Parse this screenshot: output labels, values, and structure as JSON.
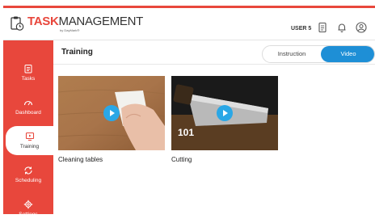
{
  "app": {
    "logo_task": "TASK",
    "logo_management": "MANAGEMENT",
    "logo_sub": "by DayMark®",
    "user_label": "USER 5",
    "accent_color": "#e8473c",
    "video_color": "#1e8fd6"
  },
  "header": {
    "icons": [
      "report-icon",
      "bell-icon",
      "user-circle-icon"
    ]
  },
  "sidebar": {
    "items": [
      {
        "label": "Tasks",
        "icon": "clipboard-icon",
        "active": false
      },
      {
        "label": "Dashboard",
        "icon": "speedometer-icon",
        "active": false
      },
      {
        "label": "Training",
        "icon": "training-screen-icon",
        "active": true
      },
      {
        "label": "Scheduling",
        "icon": "refresh-icon",
        "active": false
      },
      {
        "label": "Settings",
        "icon": "gear-icon",
        "active": false
      }
    ]
  },
  "main": {
    "title": "Training",
    "toggle": {
      "instruction": "Instruction",
      "video": "Video",
      "selected": "Video"
    },
    "videos": [
      {
        "title": "Cleaning tables",
        "thumb_text": ""
      },
      {
        "title": "Cutting",
        "thumb_text": "101"
      }
    ]
  }
}
